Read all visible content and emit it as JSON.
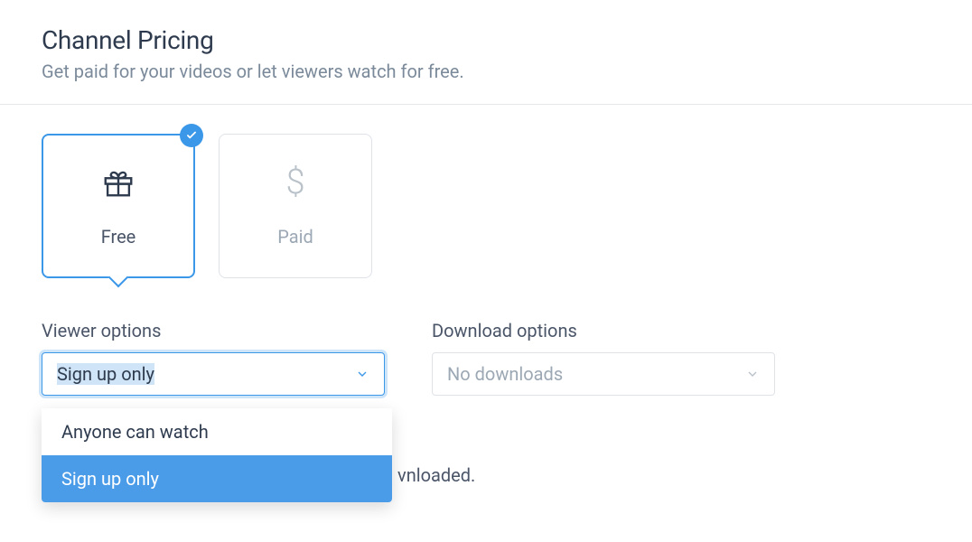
{
  "header": {
    "title": "Channel Pricing",
    "subtitle": "Get paid for your videos or let viewers watch for free."
  },
  "pricing_cards": {
    "free": {
      "label": "Free",
      "selected": true
    },
    "paid": {
      "label": "Paid",
      "selected": false
    }
  },
  "viewer_options": {
    "label": "Viewer options",
    "selected": "Sign up only",
    "items": [
      "Anyone can watch",
      "Sign up only"
    ]
  },
  "download_options": {
    "label": "Download options",
    "selected": "No downloads"
  },
  "partial_text": "vnloaded."
}
